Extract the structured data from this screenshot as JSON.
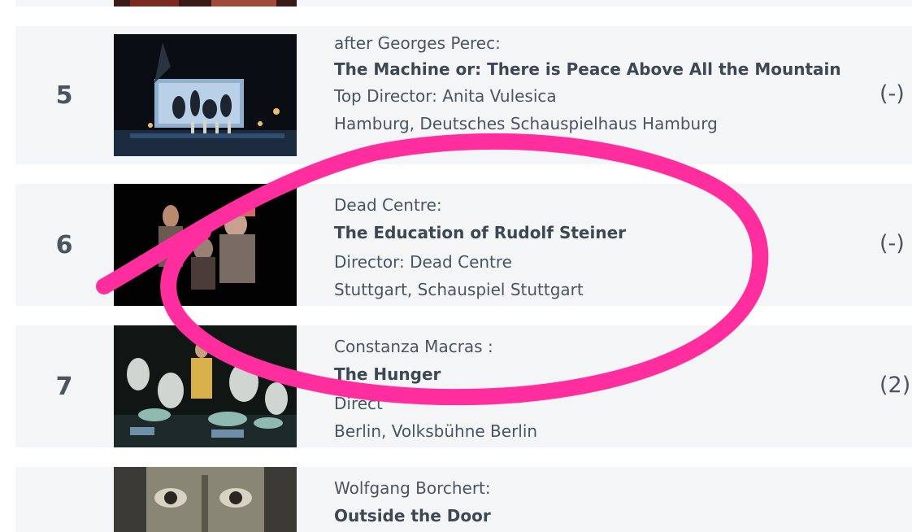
{
  "colors": {
    "card_bg": "#f4f5f7",
    "text": "#4a5560",
    "title_text": "#3e4852",
    "annotation": "#ff2d9e"
  },
  "entries": [
    {
      "rank": "5",
      "author": "after Georges Perec:",
      "title": "The Machine or: There is Peace Above All the Mountain",
      "director": "Top Director: Anita Vulesica",
      "venue": "Hamburg, Deutsches Schauspielhaus Hamburg",
      "change": "(-)"
    },
    {
      "rank": "6",
      "author": "Dead Centre:",
      "title": "The Education of Rudolf Steiner",
      "director": "Director: Dead Centre",
      "venue": "Stuttgart, Schauspiel Stuttgart",
      "change": "(-)"
    },
    {
      "rank": "7",
      "author": "Constanza Macras :",
      "title": "The Hunger",
      "director": "Direct",
      "venue": "Berlin, Volksbühne Berlin",
      "change": "(2)"
    },
    {
      "rank": "",
      "author": "Wolfgang Borchert:",
      "title": "Outside the Door",
      "director": "",
      "venue": "",
      "change": ""
    }
  ]
}
